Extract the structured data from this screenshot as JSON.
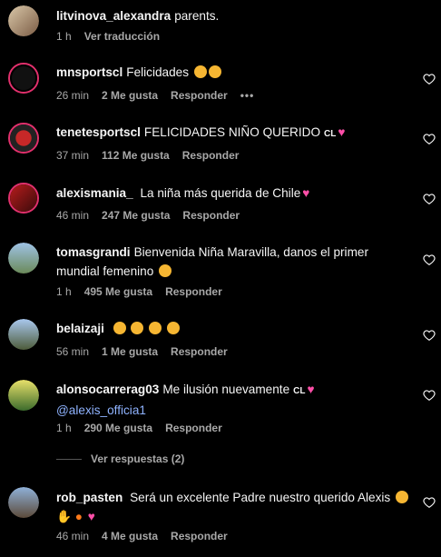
{
  "comments": [
    {
      "user": "litvinova_alexandra",
      "text": "parents.",
      "time": "1 h",
      "likes": "",
      "reply": "",
      "translate": "Ver traducción",
      "has_heart": false
    },
    {
      "user": "mnsportscl",
      "text": "Felicidades",
      "time": "26 min",
      "likes": "2 Me gusta",
      "reply": "Responder",
      "more": "•••",
      "has_heart": true
    },
    {
      "user": "tenetesportscl",
      "text": "FELICIDADES NIÑO QUERIDO",
      "time": "37 min",
      "likes": "112 Me gusta",
      "reply": "Responder",
      "has_heart": true
    },
    {
      "user": "alexismania_",
      "text": "La niña más querida de Chile",
      "time": "46 min",
      "likes": "247 Me gusta",
      "reply": "Responder",
      "has_heart": true
    },
    {
      "user": "tomasgrandi",
      "text": "Bienvenida Niña Maravilla, danos el primer mundial femenino",
      "time": "1 h",
      "likes": "495 Me gusta",
      "reply": "Responder",
      "has_heart": true
    },
    {
      "user": "belaizaji",
      "text": "",
      "time": "56 min",
      "likes": "1 Me gusta",
      "reply": "Responder",
      "has_heart": true
    },
    {
      "user": "alonsocarrerag03",
      "text": "Me ilusión nuevamente",
      "mention": "@alexis_officia1",
      "time": "1 h",
      "likes": "290 Me gusta",
      "reply": "Responder",
      "has_heart": true
    },
    {
      "user": "rob_pasten",
      "text": "Será un excelente Padre nuestro querido Alexis",
      "time": "46 min",
      "likes": "4 Me gusta",
      "reply": "Responder",
      "has_heart": true
    }
  ],
  "replies_toggle": "Ver respuestas (2)",
  "flag_text": "CL",
  "colors": {
    "background": "#000000",
    "muted": "#a8a8a8",
    "mention": "#8fb3ff",
    "heart": "#ff4fa8"
  }
}
